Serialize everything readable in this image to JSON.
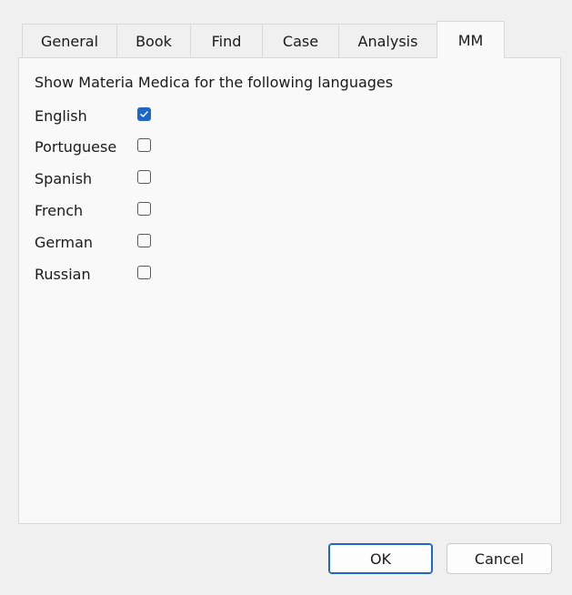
{
  "tabs": [
    {
      "label": "General"
    },
    {
      "label": "Book"
    },
    {
      "label": "Find"
    },
    {
      "label": "Case"
    },
    {
      "label": "Analysis"
    },
    {
      "label": "MM",
      "active": true
    }
  ],
  "panel": {
    "heading": "Show Materia Medica for the following languages",
    "languages": [
      {
        "label": "English",
        "checked": true
      },
      {
        "label": "Portuguese",
        "checked": false
      },
      {
        "label": "Spanish",
        "checked": false
      },
      {
        "label": "French",
        "checked": false
      },
      {
        "label": "German",
        "checked": false
      },
      {
        "label": "Russian",
        "checked": false
      }
    ]
  },
  "buttons": {
    "ok_label": "OK",
    "cancel_label": "Cancel"
  },
  "colors": {
    "accent": "#1f66c9",
    "panel_bg": "#f9f9f9",
    "window_bg": "#f0f0f0"
  }
}
